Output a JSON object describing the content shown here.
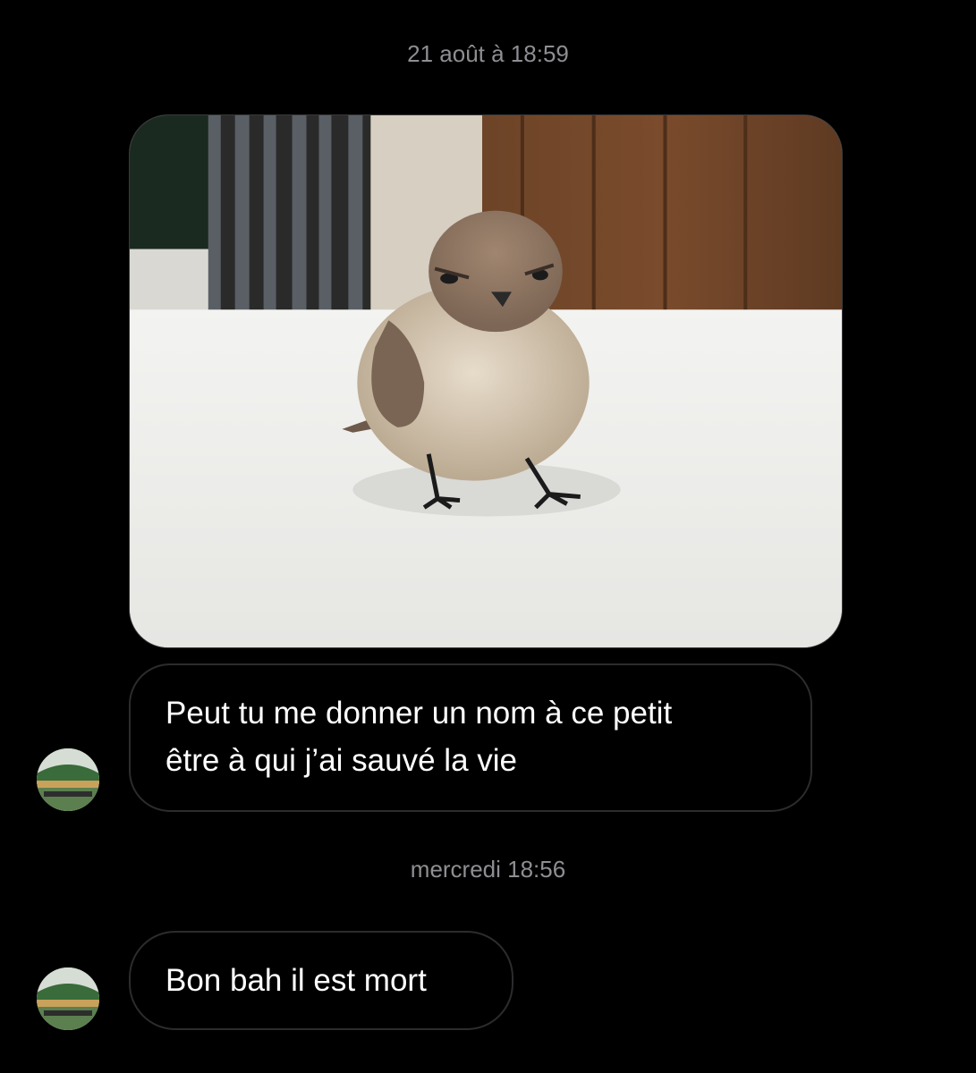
{
  "conversation": {
    "timestamps": {
      "first": "21 août à 18:59",
      "second": "mercredi 18:56"
    },
    "messages": [
      {
        "type": "photo",
        "subject": "bird-photo"
      },
      {
        "type": "text",
        "text": "Peut tu me donner un nom à ce petit\nêtre à qui j’ai sauvé la vie"
      },
      {
        "type": "text",
        "text": "Bon bah il est mort"
      }
    ]
  },
  "icons": {
    "avatar": "profile-avatar-icon"
  },
  "colors": {
    "background": "#000000",
    "timestamp": "#8e8e93",
    "bubble_border": "#2c2c2e",
    "text": "#ffffff"
  }
}
